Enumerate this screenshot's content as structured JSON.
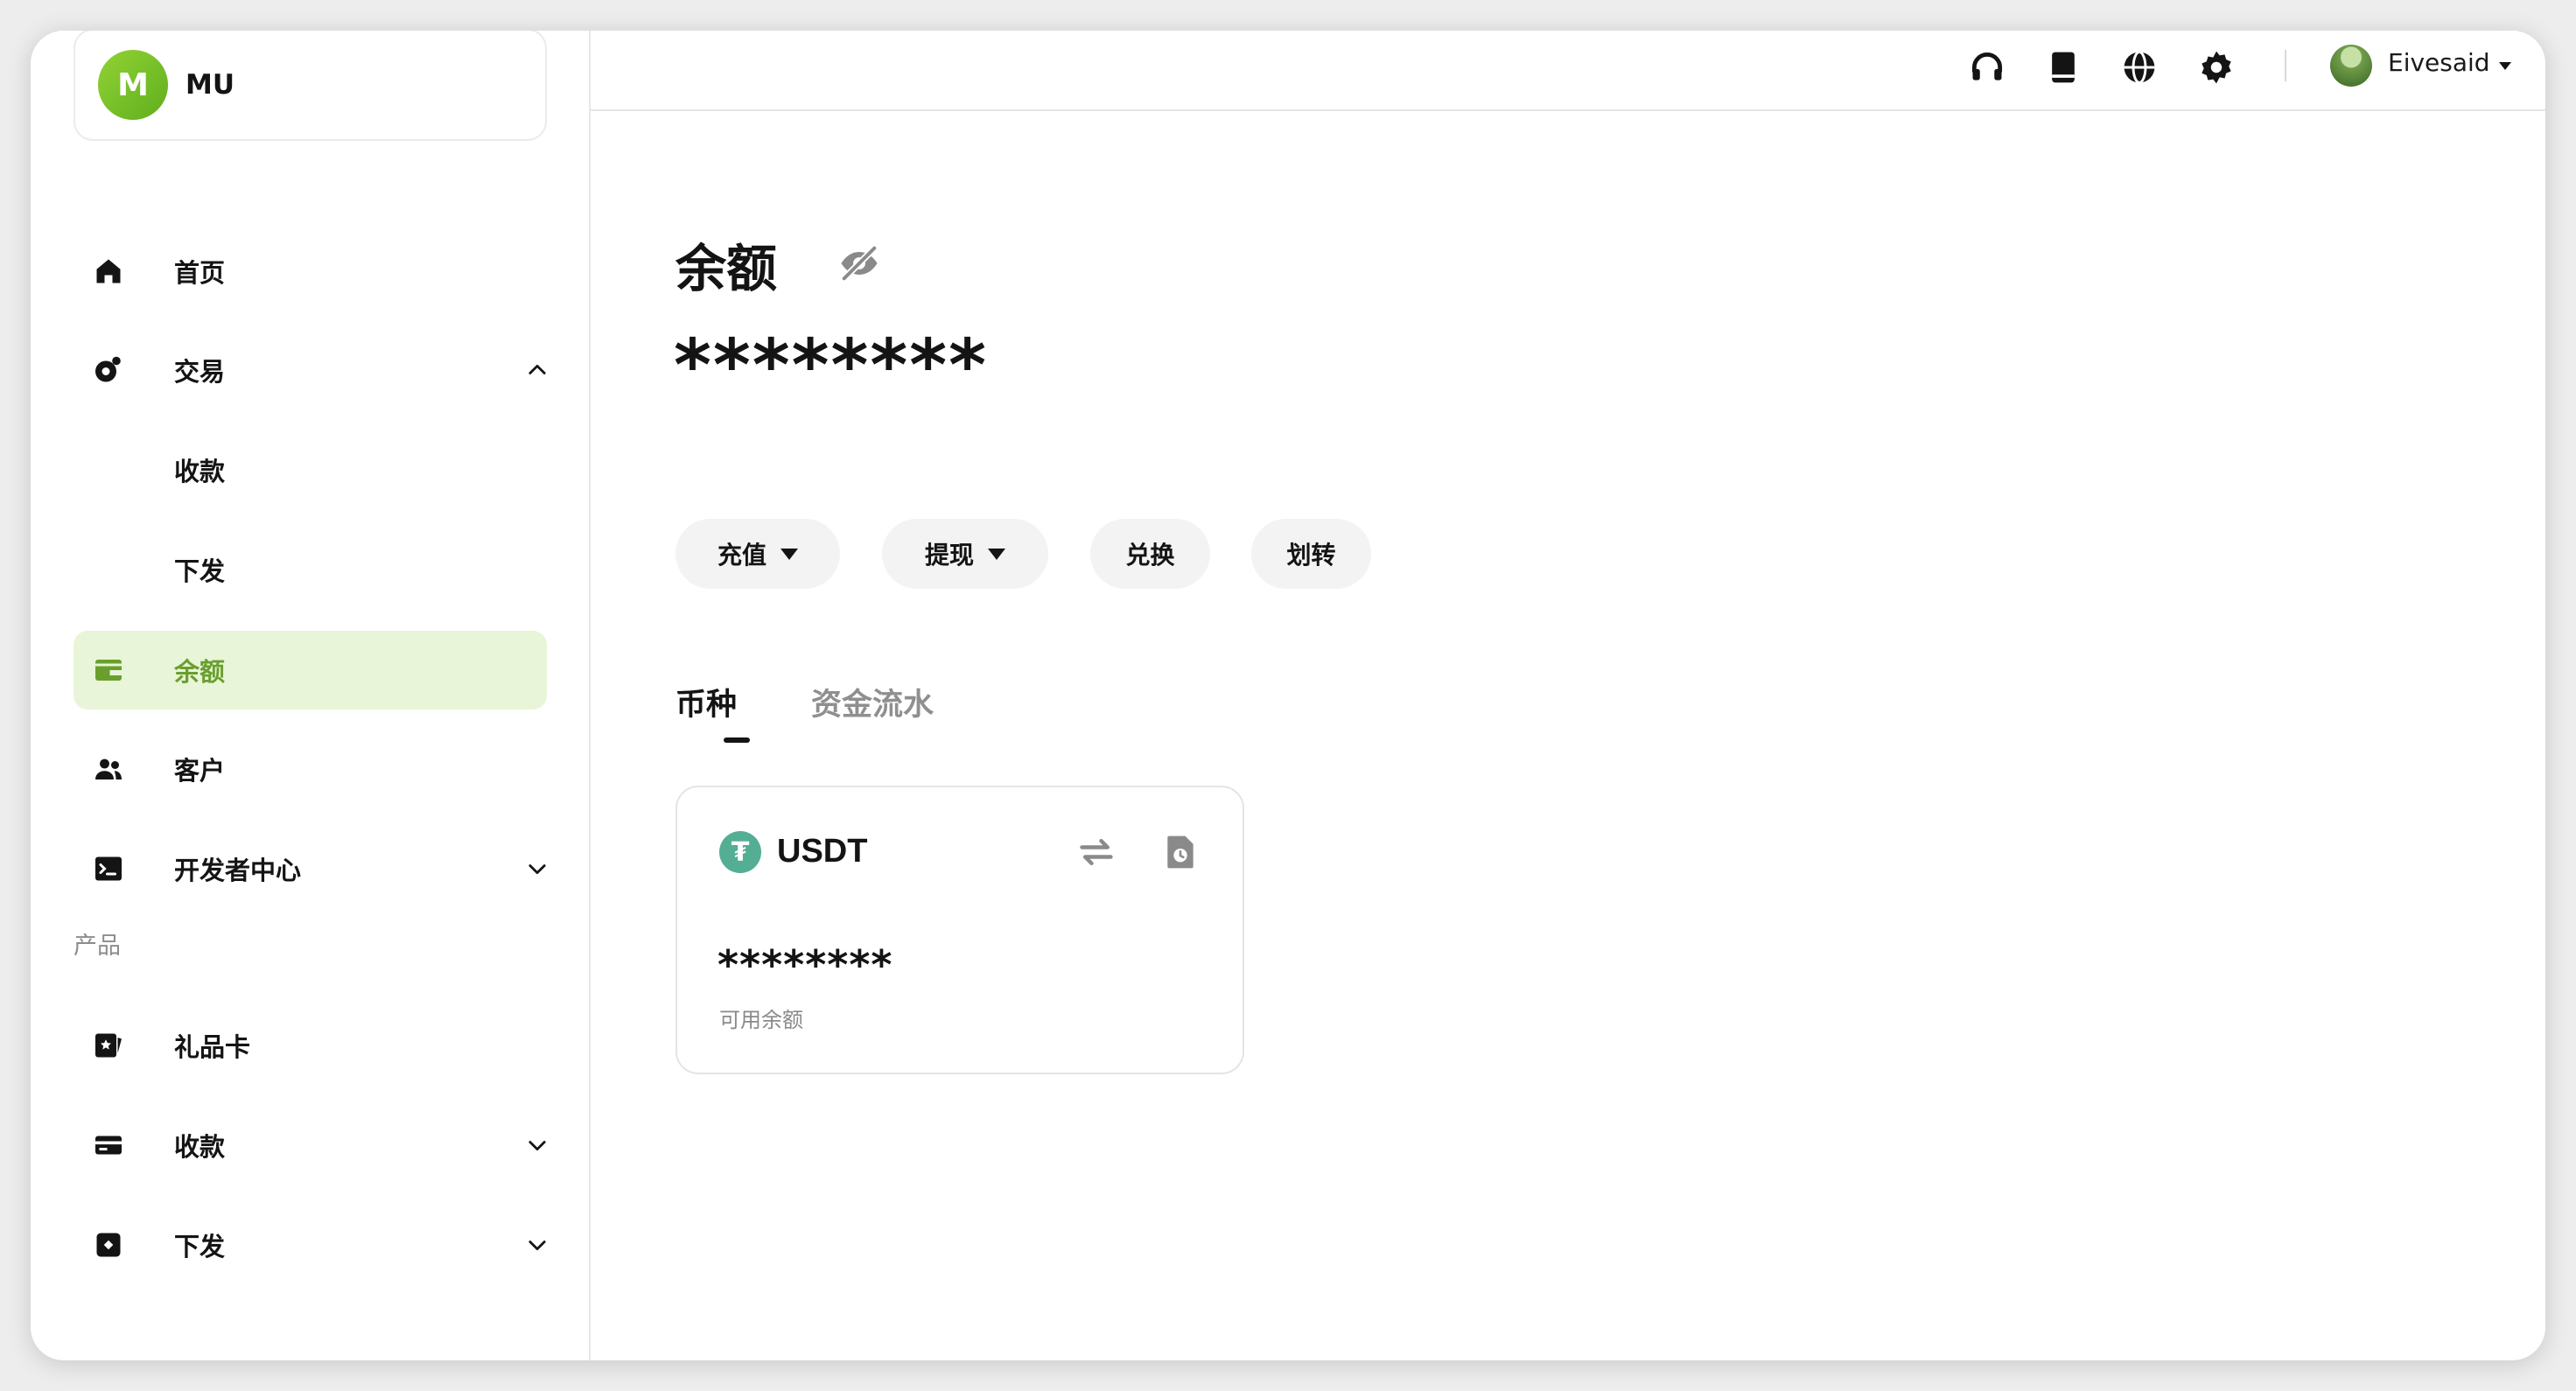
{
  "org": {
    "avatar_letter": "M",
    "name": "MU"
  },
  "sidebar": {
    "items": [
      {
        "label": "首页",
        "icon": "home-icon"
      },
      {
        "label": "交易",
        "icon": "exchange-icon",
        "expanded": true
      },
      {
        "label": "收款",
        "sub": true
      },
      {
        "label": "下发",
        "sub": true
      },
      {
        "label": "余额",
        "icon": "wallet-icon",
        "active": true
      },
      {
        "label": "客户",
        "icon": "users-icon"
      },
      {
        "label": "开发者中心",
        "icon": "terminal-icon",
        "expanded": false
      }
    ],
    "section_label": "产品",
    "product_items": [
      {
        "label": "礼品卡",
        "icon": "gift-card-icon"
      },
      {
        "label": "收款",
        "icon": "credit-card-icon",
        "expanded": false
      },
      {
        "label": "下发",
        "icon": "payout-icon",
        "expanded": false
      }
    ]
  },
  "topbar": {
    "icons": [
      "headset-icon",
      "book-icon",
      "globe-icon",
      "gear-icon"
    ],
    "user_name": "Eivesaid"
  },
  "main": {
    "title": "余额",
    "balance_masked": "********",
    "actions": [
      {
        "label": "充值",
        "dropdown": true
      },
      {
        "label": "提现",
        "dropdown": true
      },
      {
        "label": "兑换",
        "dropdown": false
      },
      {
        "label": "划转",
        "dropdown": false
      }
    ],
    "tabs": [
      {
        "label": "币种",
        "active": true
      },
      {
        "label": "资金流水",
        "active": false
      }
    ],
    "coin_card": {
      "logo_glyph": "₮",
      "name": "USDT",
      "amount_masked": "********",
      "caption": "可用余额"
    }
  },
  "colors": {
    "accent": "#6a9f2e",
    "active_bg": "#e9f5d8",
    "usdt": "#53ae94"
  }
}
